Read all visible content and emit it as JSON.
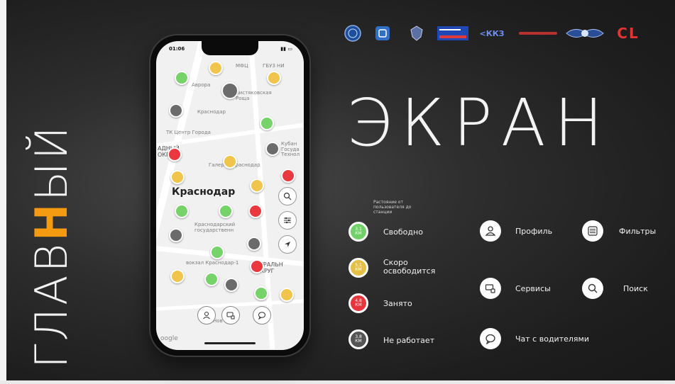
{
  "vertical_title": {
    "part1": "ГЛАВ",
    "accent": "Н",
    "part2": "ЫЙ"
  },
  "big_title": "ЭКРАН",
  "colors": {
    "accent": "#f59b12",
    "green": "#6fd167",
    "yellow": "#e5bf47",
    "red": "#e8343c",
    "gray": "#555555"
  },
  "logos": [
    {
      "name": "emblem-round-logo"
    },
    {
      "name": "blue-square-logo"
    },
    {
      "name": "eagle-crest-logo"
    },
    {
      "name": "blue-card-logo"
    },
    {
      "name": "kkz-logo",
      "text": "<ККЗ"
    },
    {
      "name": "red-text-logo"
    },
    {
      "name": "winged-emblem-logo"
    },
    {
      "name": "cl-logo",
      "text": "CL"
    }
  ],
  "phone": {
    "time": "01:06",
    "city": "Краснодар",
    "map_labels": [
      "МФЦ",
      "ГБУЗ НИ",
      "Аврора",
      "Чистяковская Роща",
      "Краснодар",
      "ТК Центр Города",
      "Кубан Госуда Технол",
      "АДНЫЙ ОКРУГ",
      "Галерея Краснодар",
      "Краснодарский государственн",
      "вокзал Краснодар-1",
      "НТРАЛЬН ОКРУГ",
      "Нов",
      "oogle"
    ]
  },
  "legend": {
    "caption": "Растояние от пользователя до станции",
    "items": [
      {
        "value": "3.1",
        "unit": "КМ",
        "label": "Свободно",
        "color": "green"
      },
      {
        "value": "5.1",
        "unit": "КМ",
        "label": "Скоро освободится",
        "color": "yellow"
      },
      {
        "value": "4.8",
        "unit": "КМ",
        "label": "Занято",
        "color": "red"
      },
      {
        "value": "3.8",
        "unit": "КМ",
        "label": "Не работает",
        "color": "gray"
      }
    ]
  },
  "features": [
    {
      "icon": "profile-icon",
      "label": "Профиль"
    },
    {
      "icon": "filters-icon",
      "label": "Фильтры"
    },
    {
      "icon": "services-icon",
      "label": "Сервисы"
    },
    {
      "icon": "search-icon",
      "label": "Поиск"
    },
    {
      "icon": "chat-icon",
      "label": "Чат с водителями"
    }
  ]
}
